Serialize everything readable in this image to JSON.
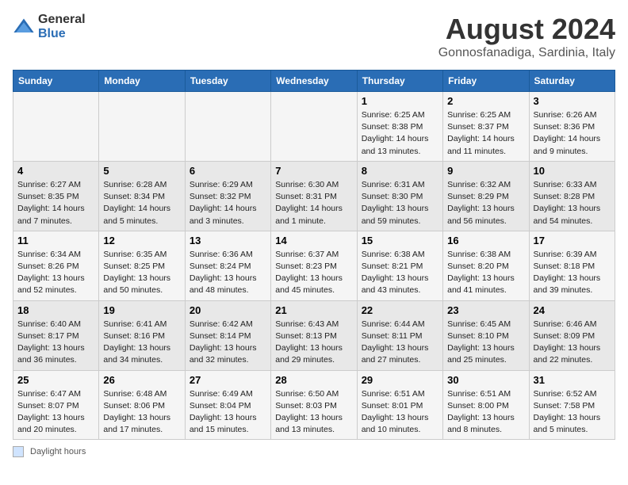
{
  "logo": {
    "general": "General",
    "blue": "Blue"
  },
  "title": "August 2024",
  "subtitle": "Gonnosfanadiga, Sardinia, Italy",
  "days_of_week": [
    "Sunday",
    "Monday",
    "Tuesday",
    "Wednesday",
    "Thursday",
    "Friday",
    "Saturday"
  ],
  "weeks": [
    [
      {
        "day": "",
        "info": ""
      },
      {
        "day": "",
        "info": ""
      },
      {
        "day": "",
        "info": ""
      },
      {
        "day": "",
        "info": ""
      },
      {
        "day": "1",
        "info": "Sunrise: 6:25 AM\nSunset: 8:38 PM\nDaylight: 14 hours and 13 minutes."
      },
      {
        "day": "2",
        "info": "Sunrise: 6:25 AM\nSunset: 8:37 PM\nDaylight: 14 hours and 11 minutes."
      },
      {
        "day": "3",
        "info": "Sunrise: 6:26 AM\nSunset: 8:36 PM\nDaylight: 14 hours and 9 minutes."
      }
    ],
    [
      {
        "day": "4",
        "info": "Sunrise: 6:27 AM\nSunset: 8:35 PM\nDaylight: 14 hours and 7 minutes."
      },
      {
        "day": "5",
        "info": "Sunrise: 6:28 AM\nSunset: 8:34 PM\nDaylight: 14 hours and 5 minutes."
      },
      {
        "day": "6",
        "info": "Sunrise: 6:29 AM\nSunset: 8:32 PM\nDaylight: 14 hours and 3 minutes."
      },
      {
        "day": "7",
        "info": "Sunrise: 6:30 AM\nSunset: 8:31 PM\nDaylight: 14 hours and 1 minute."
      },
      {
        "day": "8",
        "info": "Sunrise: 6:31 AM\nSunset: 8:30 PM\nDaylight: 13 hours and 59 minutes."
      },
      {
        "day": "9",
        "info": "Sunrise: 6:32 AM\nSunset: 8:29 PM\nDaylight: 13 hours and 56 minutes."
      },
      {
        "day": "10",
        "info": "Sunrise: 6:33 AM\nSunset: 8:28 PM\nDaylight: 13 hours and 54 minutes."
      }
    ],
    [
      {
        "day": "11",
        "info": "Sunrise: 6:34 AM\nSunset: 8:26 PM\nDaylight: 13 hours and 52 minutes."
      },
      {
        "day": "12",
        "info": "Sunrise: 6:35 AM\nSunset: 8:25 PM\nDaylight: 13 hours and 50 minutes."
      },
      {
        "day": "13",
        "info": "Sunrise: 6:36 AM\nSunset: 8:24 PM\nDaylight: 13 hours and 48 minutes."
      },
      {
        "day": "14",
        "info": "Sunrise: 6:37 AM\nSunset: 8:23 PM\nDaylight: 13 hours and 45 minutes."
      },
      {
        "day": "15",
        "info": "Sunrise: 6:38 AM\nSunset: 8:21 PM\nDaylight: 13 hours and 43 minutes."
      },
      {
        "day": "16",
        "info": "Sunrise: 6:38 AM\nSunset: 8:20 PM\nDaylight: 13 hours and 41 minutes."
      },
      {
        "day": "17",
        "info": "Sunrise: 6:39 AM\nSunset: 8:18 PM\nDaylight: 13 hours and 39 minutes."
      }
    ],
    [
      {
        "day": "18",
        "info": "Sunrise: 6:40 AM\nSunset: 8:17 PM\nDaylight: 13 hours and 36 minutes."
      },
      {
        "day": "19",
        "info": "Sunrise: 6:41 AM\nSunset: 8:16 PM\nDaylight: 13 hours and 34 minutes."
      },
      {
        "day": "20",
        "info": "Sunrise: 6:42 AM\nSunset: 8:14 PM\nDaylight: 13 hours and 32 minutes."
      },
      {
        "day": "21",
        "info": "Sunrise: 6:43 AM\nSunset: 8:13 PM\nDaylight: 13 hours and 29 minutes."
      },
      {
        "day": "22",
        "info": "Sunrise: 6:44 AM\nSunset: 8:11 PM\nDaylight: 13 hours and 27 minutes."
      },
      {
        "day": "23",
        "info": "Sunrise: 6:45 AM\nSunset: 8:10 PM\nDaylight: 13 hours and 25 minutes."
      },
      {
        "day": "24",
        "info": "Sunrise: 6:46 AM\nSunset: 8:09 PM\nDaylight: 13 hours and 22 minutes."
      }
    ],
    [
      {
        "day": "25",
        "info": "Sunrise: 6:47 AM\nSunset: 8:07 PM\nDaylight: 13 hours and 20 minutes."
      },
      {
        "day": "26",
        "info": "Sunrise: 6:48 AM\nSunset: 8:06 PM\nDaylight: 13 hours and 17 minutes."
      },
      {
        "day": "27",
        "info": "Sunrise: 6:49 AM\nSunset: 8:04 PM\nDaylight: 13 hours and 15 minutes."
      },
      {
        "day": "28",
        "info": "Sunrise: 6:50 AM\nSunset: 8:03 PM\nDaylight: 13 hours and 13 minutes."
      },
      {
        "day": "29",
        "info": "Sunrise: 6:51 AM\nSunset: 8:01 PM\nDaylight: 13 hours and 10 minutes."
      },
      {
        "day": "30",
        "info": "Sunrise: 6:51 AM\nSunset: 8:00 PM\nDaylight: 13 hours and 8 minutes."
      },
      {
        "day": "31",
        "info": "Sunrise: 6:52 AM\nSunset: 7:58 PM\nDaylight: 13 hours and 5 minutes."
      }
    ]
  ],
  "legend": {
    "label": "Daylight hours"
  }
}
